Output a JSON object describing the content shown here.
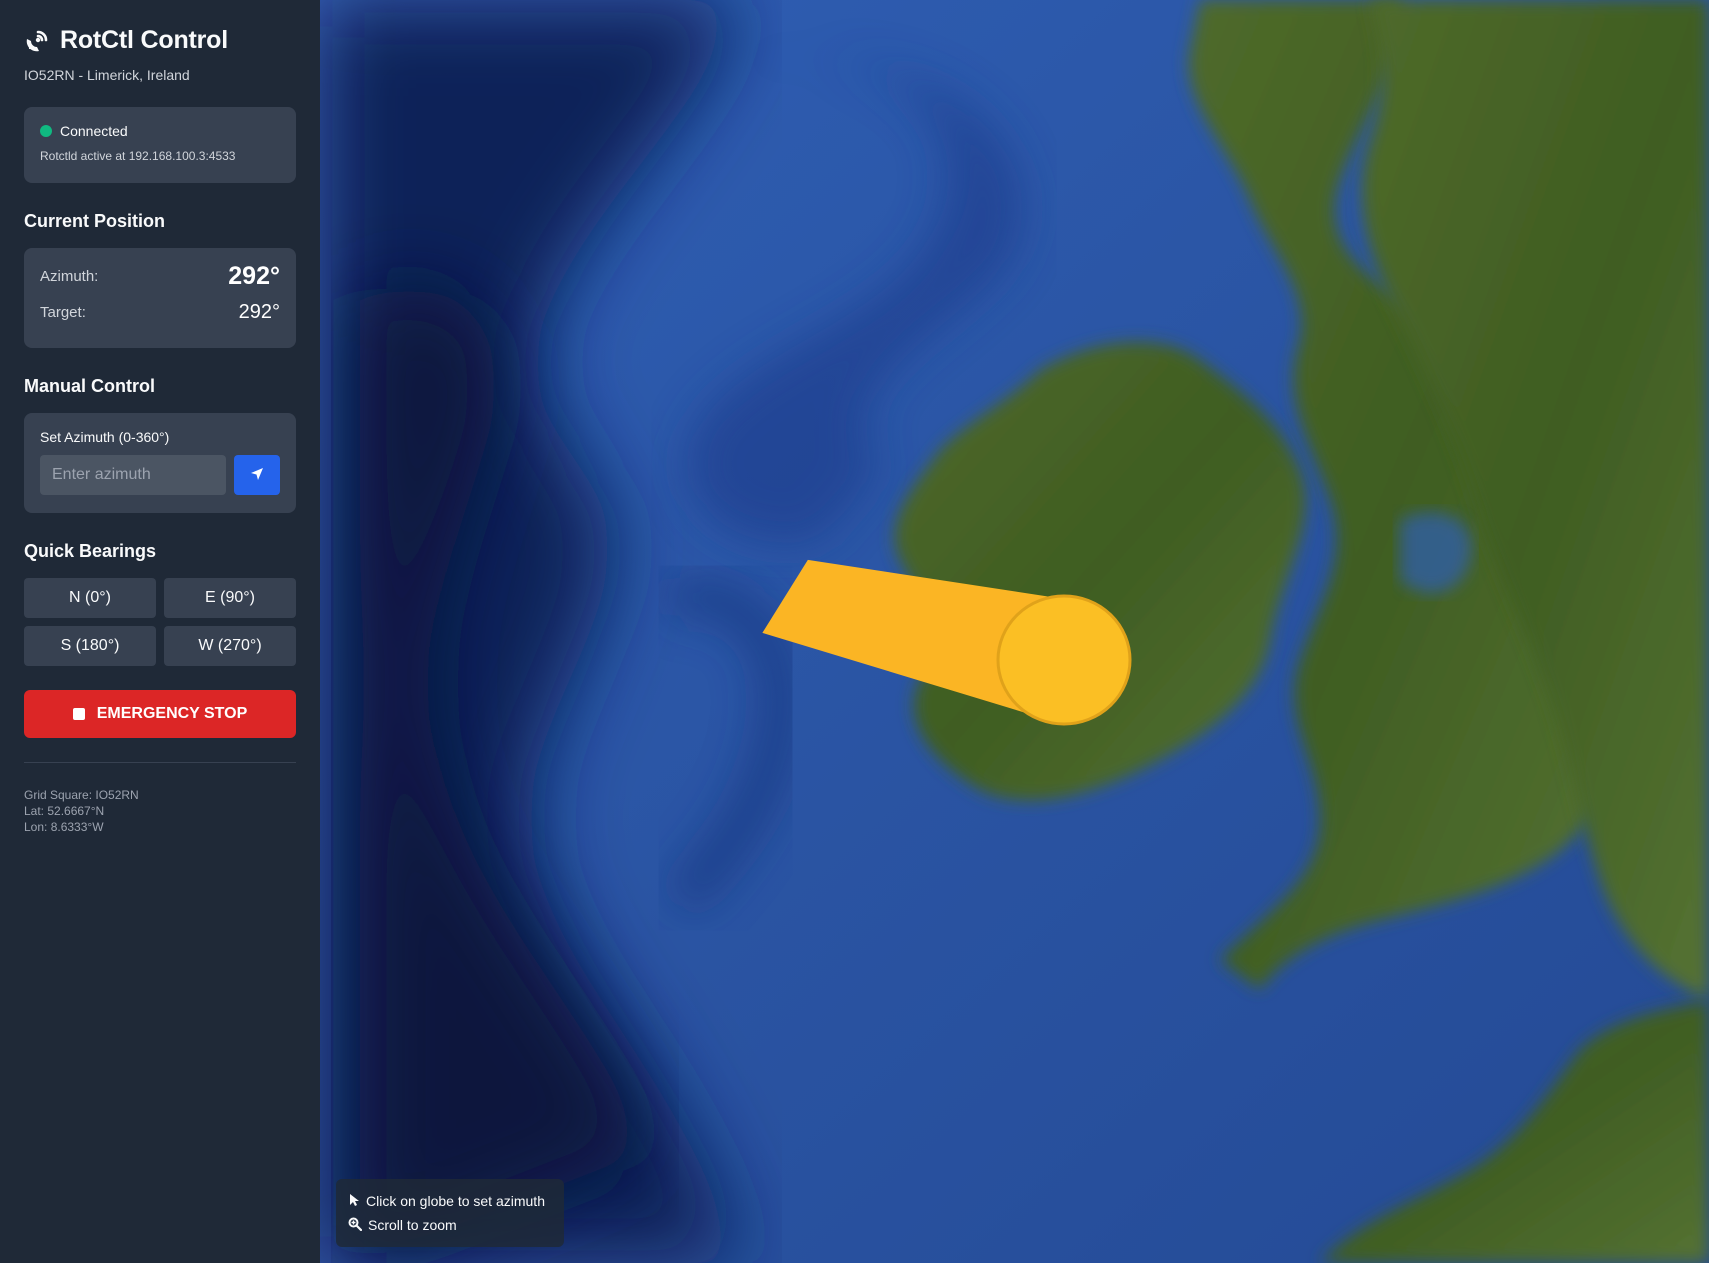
{
  "app": {
    "title": "RotCtl Control",
    "location": "IO52RN - Limerick, Ireland"
  },
  "status": {
    "state": "Connected",
    "detail": "Rotctld active at 192.168.100.3:4533",
    "color": "#10b981"
  },
  "position": {
    "section_title": "Current Position",
    "azimuth_label": "Azimuth:",
    "azimuth_value": "292°",
    "target_label": "Target:",
    "target_value": "292°"
  },
  "manual": {
    "section_title": "Manual Control",
    "input_label": "Set Azimuth (0-360°)",
    "input_placeholder": "Enter azimuth",
    "input_value": "",
    "send_icon": "send-arrow-icon"
  },
  "quick": {
    "section_title": "Quick Bearings",
    "buttons": [
      "N (0°)",
      "E (90°)",
      "S (180°)",
      "W (270°)"
    ]
  },
  "estop": {
    "label": "EMERGENCY STOP",
    "color": "#dc2626"
  },
  "grid_info": {
    "grid": "Grid Square: IO52RN",
    "lat": "Lat: 52.6667°N",
    "lon": "Lon: 8.6333°W"
  },
  "map": {
    "beam_color": "#fbbf24",
    "beam_bearing_deg": 292,
    "hints": [
      "Click on globe to set azimuth",
      "Scroll to zoom"
    ],
    "hint_icons": [
      "cursor-pointer-icon",
      "zoom-icon"
    ]
  }
}
